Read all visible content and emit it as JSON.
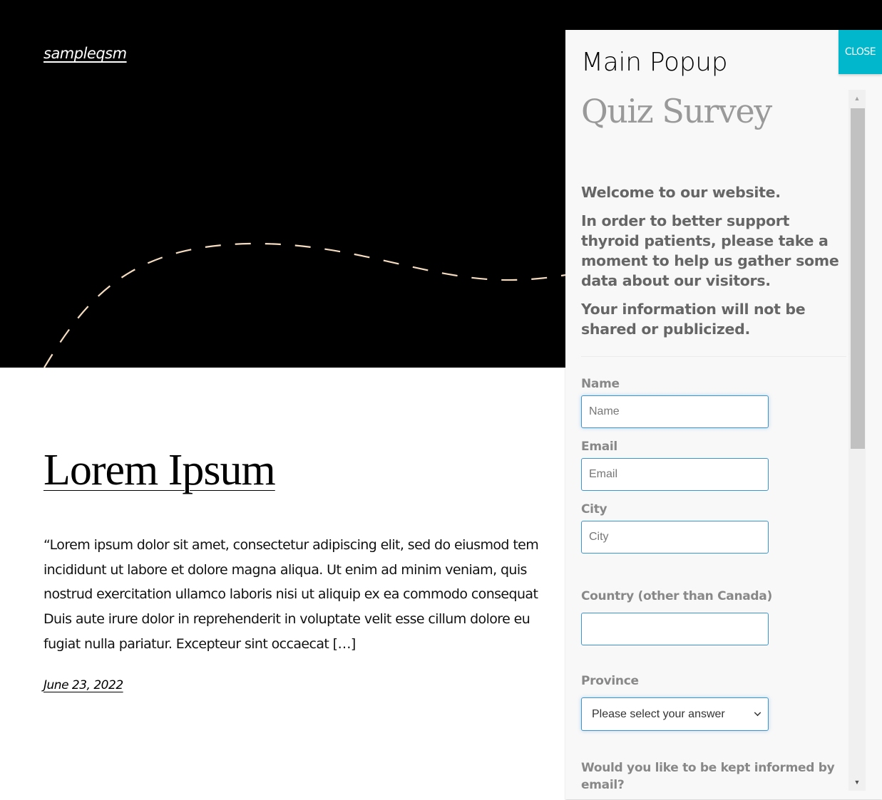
{
  "site": {
    "title": "sampleqsm",
    "accent_color": "#00b7cc",
    "curve_color": "#f5dcc0"
  },
  "post": {
    "title": "Lorem Ipsum",
    "excerpt_lines": [
      "“Lorem ipsum dolor sit amet, consectetur adipiscing elit, sed do eiusmod tem",
      "incididunt ut labore et dolore magna aliqua. Ut enim ad minim veniam, quis",
      "nostrud exercitation ullamco laboris nisi ut aliquip ex ea commodo consequat",
      "Duis aute irure dolor in reprehenderit in voluptate velit esse cillum dolore eu",
      "fugiat nulla pariatur. Excepteur sint occaecat […]"
    ],
    "date": "June 23, 2022"
  },
  "popup": {
    "title": "Main Popup",
    "close_label": "CLOSE",
    "quiz_name": "Quiz Survey",
    "intro": [
      "Welcome to our website.",
      "In order to better support thyroid patients, please take a moment to help us gather some data about our visitors.",
      "Your information will not be shared or publicized."
    ],
    "fields": {
      "name": {
        "label": "Name",
        "placeholder": "Name",
        "value": ""
      },
      "email": {
        "label": "Email",
        "placeholder": "Email",
        "value": ""
      },
      "city": {
        "label": "City",
        "placeholder": "City",
        "value": ""
      },
      "country": {
        "label": "Country (other than Canada)",
        "placeholder": "",
        "value": ""
      },
      "province": {
        "label": "Province",
        "selected": "Please select your answer"
      },
      "email_opt_in": {
        "label": "Would you like to be kept informed by email?"
      }
    },
    "scrollbar": {
      "up_icon": "▲",
      "down_icon": "▼",
      "scroll_position": 0
    }
  }
}
